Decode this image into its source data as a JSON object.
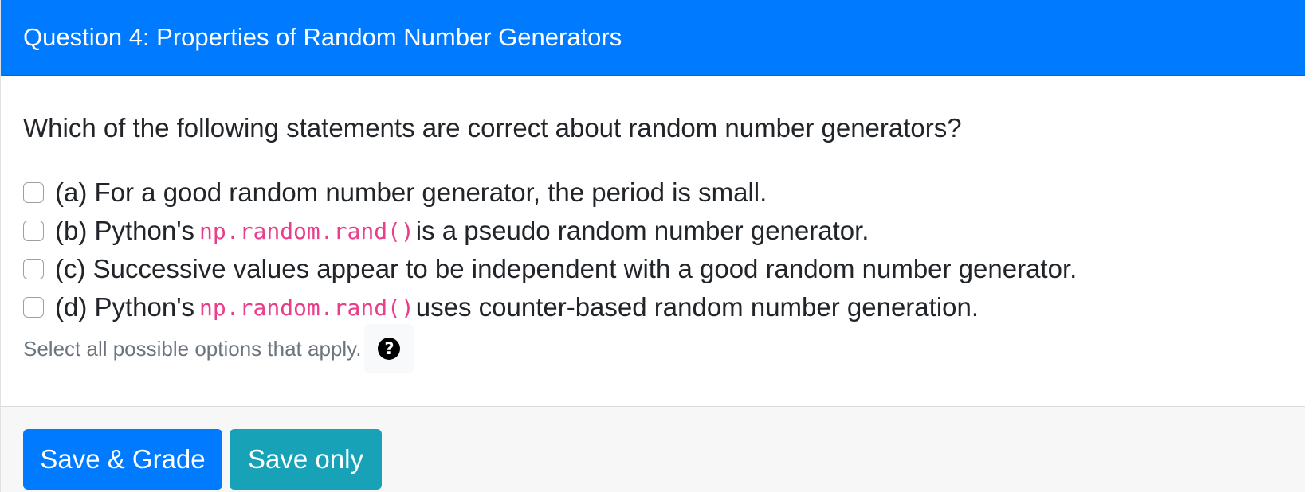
{
  "header": {
    "title": "Question 4: Properties of Random Number Generators"
  },
  "question": {
    "text": "Which of the following statements are correct about random number generators?",
    "options": [
      {
        "checked": false,
        "before": "(a) For a good random number generator, the period is small.",
        "code": "",
        "after": ""
      },
      {
        "checked": false,
        "before": "(b) Python's",
        "code": "np.random.rand()",
        "after": "is a pseudo random number generator."
      },
      {
        "checked": false,
        "before": "(c) Successive values appear to be independent with a good random number generator.",
        "code": "",
        "after": ""
      },
      {
        "checked": false,
        "before": "(d) Python's",
        "code": "np.random.rand()",
        "after": "uses counter-based random number generation."
      }
    ],
    "help_text": "Select all possible options that apply.",
    "help_icon": "question-circle-icon"
  },
  "footer": {
    "save_grade_label": "Save & Grade",
    "save_only_label": "Save only"
  },
  "colors": {
    "header_bg": "#007bff",
    "primary_button": "#007bff",
    "info_button": "#17a2b8",
    "code_text": "#e83e8c"
  }
}
